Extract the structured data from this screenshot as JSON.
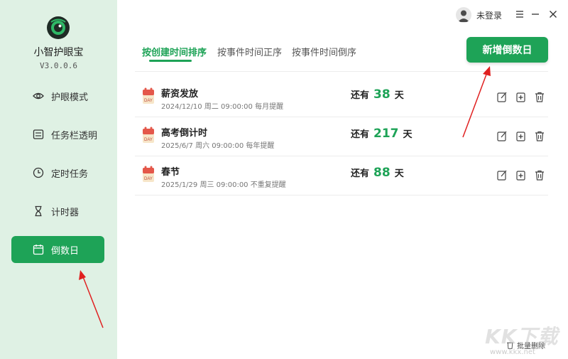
{
  "app": {
    "name": "小智护眼宝",
    "version": "V3.0.0.6"
  },
  "sidebar": {
    "items": [
      {
        "label": "护眼模式",
        "icon": "eye-icon",
        "active": false
      },
      {
        "label": "任务栏透明",
        "icon": "taskbar-icon",
        "active": false
      },
      {
        "label": "定时任务",
        "icon": "clock-icon",
        "active": false
      },
      {
        "label": "计时器",
        "icon": "hourglass-icon",
        "active": false
      },
      {
        "label": "倒数日",
        "icon": "calendar-icon",
        "active": true
      }
    ]
  },
  "header": {
    "user_label": "未登录"
  },
  "tabs": [
    {
      "label": "按创建时间排序",
      "active": true
    },
    {
      "label": "按事件时间正序",
      "active": false
    },
    {
      "label": "按事件时间倒序",
      "active": false
    }
  ],
  "toolbar": {
    "add_label": "新增倒数日"
  },
  "events": [
    {
      "title": "薪资发放",
      "subtitle": "2024/12/10 周二 09:00:00 每月提醒",
      "prefix": "还有",
      "days": "38",
      "suffix": "天"
    },
    {
      "title": "高考倒计时",
      "subtitle": "2025/6/7 周六 09:00:00 每年提醒",
      "prefix": "还有",
      "days": "217",
      "suffix": "天"
    },
    {
      "title": "春节",
      "subtitle": "2025/1/29 周三 09:00:00 不重复提醒",
      "prefix": "还有",
      "days": "88",
      "suffix": "天"
    }
  ],
  "footer": {
    "bulk_delete_label": "批量删除"
  },
  "watermark": {
    "text": "KK下载",
    "url": "www.kkx.net"
  },
  "colors": {
    "accent": "#1ea357",
    "sidebar_bg": "#dff1e4",
    "annotation_arrow": "#e02020"
  }
}
